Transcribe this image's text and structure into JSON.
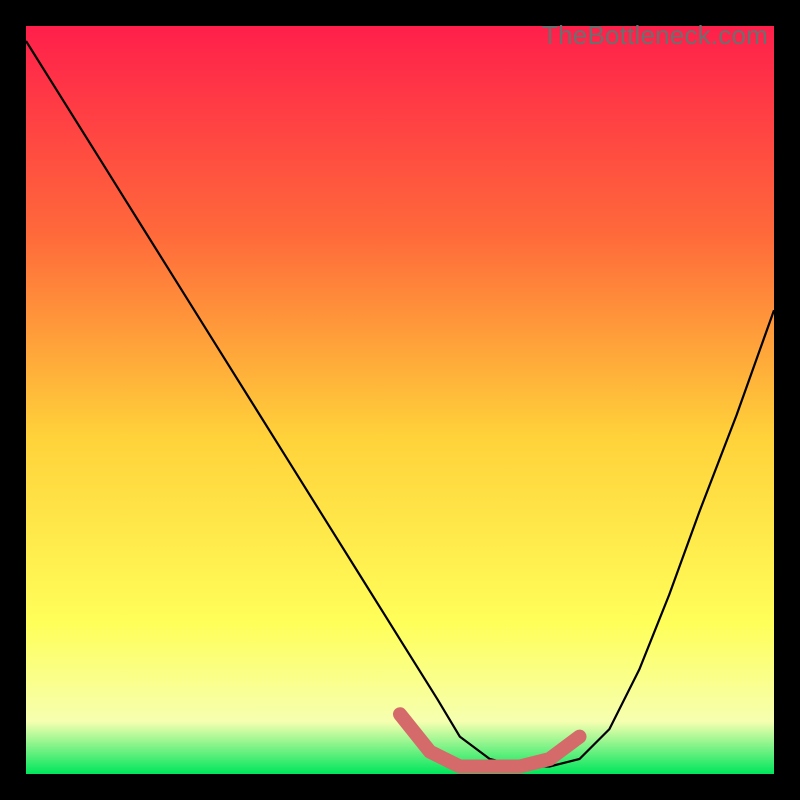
{
  "watermark": "TheBottleneck.com",
  "colors": {
    "black": "#000000",
    "curve": "#000000",
    "accent_pink": "#d46a6a",
    "gradient_top": "#ff1f4b",
    "gradient_mid1": "#ff6a3a",
    "gradient_mid2": "#ffd23a",
    "gradient_mid3": "#ffff5a",
    "gradient_mid4": "#f6ffb0",
    "gradient_bottom": "#00e65c"
  },
  "chart_data": {
    "type": "line",
    "title": "",
    "xlabel": "",
    "ylabel": "",
    "xlim": [
      0,
      100
    ],
    "ylim": [
      0,
      100
    ],
    "series": [
      {
        "name": "bottleneck-curve",
        "x": [
          0,
          5,
          10,
          15,
          20,
          25,
          30,
          35,
          40,
          45,
          50,
          55,
          58,
          62,
          66,
          70,
          74,
          78,
          82,
          86,
          90,
          95,
          100
        ],
        "y": [
          98,
          90,
          82,
          74,
          66,
          58,
          50,
          42,
          34,
          26,
          18,
          10,
          5,
          2,
          1,
          1,
          2,
          6,
          14,
          24,
          35,
          48,
          62
        ]
      }
    ],
    "annotations": [
      {
        "name": "bottom-accent",
        "type": "path",
        "x": [
          50,
          54,
          58,
          62,
          66,
          70,
          74
        ],
        "y": [
          8,
          3,
          1,
          1,
          1,
          2,
          5
        ]
      }
    ]
  }
}
